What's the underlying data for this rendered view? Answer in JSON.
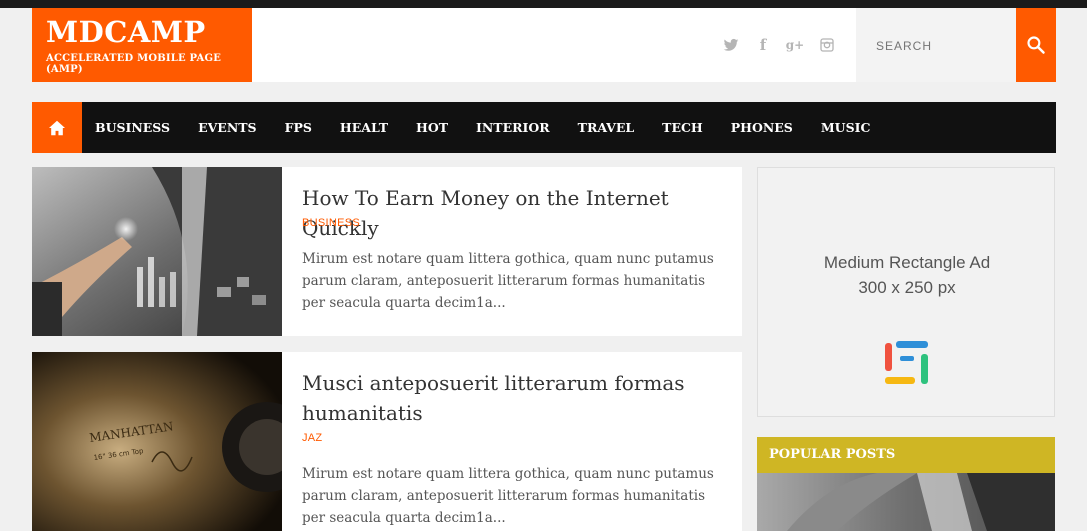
{
  "site": {
    "title": "MDCAMP",
    "subtitle": "ACCELERATED MOBILE PAGE (AMP)"
  },
  "social": [
    {
      "name": "twitter-icon"
    },
    {
      "name": "facebook-icon",
      "glyph": "f"
    },
    {
      "name": "google-plus-icon",
      "glyph": "g+"
    },
    {
      "name": "instagram-icon"
    }
  ],
  "search": {
    "placeholder": "SEARCH"
  },
  "nav": {
    "items": [
      "BUSINESS",
      "EVENTS",
      "FPS",
      "HEALT",
      "HOT",
      "INTERIOR",
      "TRAVEL",
      "TECH",
      "PHONES",
      "MUSIC"
    ]
  },
  "posts": [
    {
      "title": "How To Earn Money on the Internet Quickly",
      "category": "BUSINESS",
      "excerpt": "Mirum est notare quam littera gothica, quam nunc putamus parum claram, anteposuerit litterarum formas humanitatis per seacula quarta decim1a..."
    },
    {
      "title": "Musci anteposuerit litterarum formas humanitatis",
      "category": "JAZ",
      "excerpt": "Mirum est notare quam littera gothica, quam nunc putamus parum claram, anteposuerit litterarum formas humanitatis per seacula quarta decim1a..."
    }
  ],
  "ad": {
    "line1": "Medium Rectangle Ad",
    "line2": "300 x 250 px"
  },
  "sidebar": {
    "popular_title": "POPULAR POSTS"
  },
  "colors": {
    "accent": "#ff5a00",
    "nav_bg": "#111111",
    "popular_bg": "#cfb624"
  }
}
